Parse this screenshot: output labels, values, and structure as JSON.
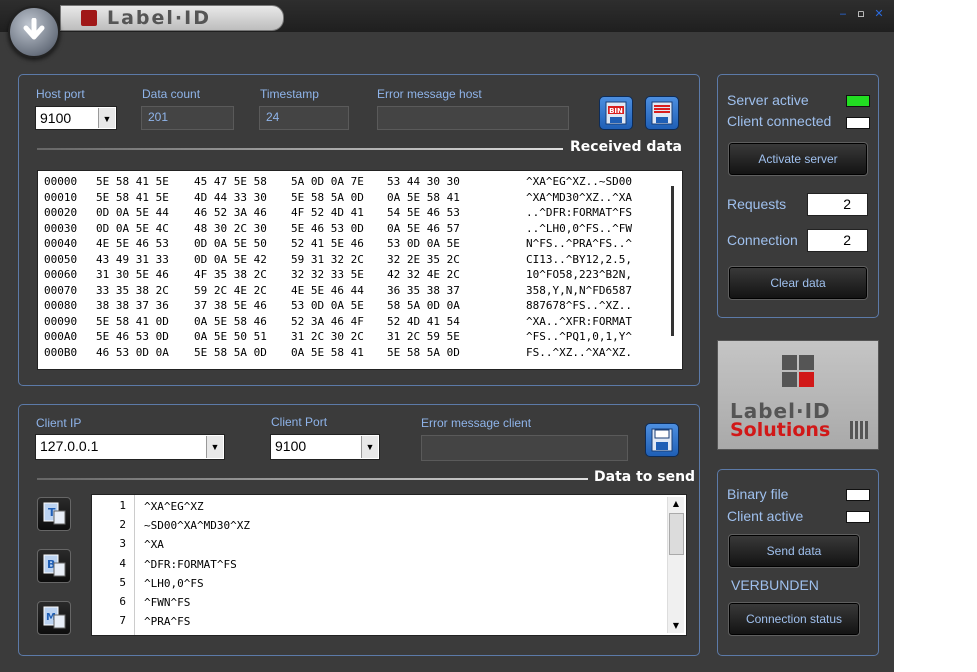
{
  "app": {
    "title": "Label·ID"
  },
  "host": {
    "host_port_label": "Host port",
    "host_port_value": "9100",
    "data_count_label": "Data count",
    "data_count_value": "201",
    "timestamp_label": "Timestamp",
    "timestamp_value": "24",
    "error_label": "Error message host",
    "error_value": "",
    "received_title": "Received data",
    "bin_icon_text": "BIN",
    "hex_rows": [
      {
        "addr": "00000",
        "hex": [
          "5E 58 41 5E",
          "45 47 5E 58",
          "5A 0D 0A 7E",
          "53 44 30 30"
        ],
        "ascii": "^XA^EG^XZ..~SD00"
      },
      {
        "addr": "00010",
        "hex": [
          "5E 58 41 5E",
          "4D 44 33 30",
          "5E 58 5A 0D",
          "0A 5E 58 41"
        ],
        "ascii": "^XA^MD30^XZ..^XA"
      },
      {
        "addr": "00020",
        "hex": [
          "0D 0A 5E 44",
          "46 52 3A 46",
          "4F 52 4D 41",
          "54 5E 46 53"
        ],
        "ascii": "..^DFR:FORMAT^FS"
      },
      {
        "addr": "00030",
        "hex": [
          "0D 0A 5E 4C",
          "48 30 2C 30",
          "5E 46 53 0D",
          "0A 5E 46 57"
        ],
        "ascii": "..^LH0,0^FS..^FW"
      },
      {
        "addr": "00040",
        "hex": [
          "4E 5E 46 53",
          "0D 0A 5E 50",
          "52 41 5E 46",
          "53 0D 0A 5E"
        ],
        "ascii": "N^FS..^PRA^FS..^"
      },
      {
        "addr": "00050",
        "hex": [
          "43 49 31 33",
          "0D 0A 5E 42",
          "59 31 32 2C",
          "32 2E 35 2C"
        ],
        "ascii": "CI13..^BY12,2.5,"
      },
      {
        "addr": "00060",
        "hex": [
          "31 30 5E 46",
          "4F 35 38 2C",
          "32 32 33 5E",
          "42 32 4E 2C"
        ],
        "ascii": "10^FO58,223^B2N,"
      },
      {
        "addr": "00070",
        "hex": [
          "33 35 38 2C",
          "59 2C 4E 2C",
          "4E 5E 46 44",
          "36 35 38 37"
        ],
        "ascii": "358,Y,N,N^FD6587"
      },
      {
        "addr": "00080",
        "hex": [
          "38 38 37 36",
          "37 38 5E 46",
          "53 0D 0A 5E",
          "58 5A 0D 0A"
        ],
        "ascii": "887678^FS..^XZ.."
      },
      {
        "addr": "00090",
        "hex": [
          "5E 58 41 0D",
          "0A 5E 58 46",
          "52 3A 46 4F",
          "52 4D 41 54"
        ],
        "ascii": "^XA..^XFR:FORMAT"
      },
      {
        "addr": "000A0",
        "hex": [
          "5E 46 53 0D",
          "0A 5E 50 51",
          "31 2C 30 2C",
          "31 2C 59 5E"
        ],
        "ascii": "^FS..^PQ1,0,1,Y^"
      },
      {
        "addr": "000B0",
        "hex": [
          "46 53 0D 0A",
          "5E 58 5A 0D",
          "0A 5E 58 41",
          "5E 58 5A 0D"
        ],
        "ascii": "FS..^XZ..^XA^XZ."
      }
    ]
  },
  "client": {
    "client_ip_label": "Client IP",
    "client_ip_value": "127.0.0.1",
    "client_port_label": "Client Port",
    "client_port_value": "9100",
    "error_label": "Error message client",
    "error_value": "",
    "send_title": "Data to send",
    "lines": [
      "^XA^EG^XZ",
      "~SD00^XA^MD30^XZ",
      "^XA",
      "^DFR:FORMAT^FS",
      "^LH0,0^FS",
      "^FWN^FS",
      "^PRA^FS",
      ""
    ]
  },
  "server": {
    "server_active_label": "Server active",
    "client_connected_label": "Client connected",
    "activate_label": "Activate server",
    "requests_label": "Requests",
    "requests_value": "2",
    "connection_label": "Connection",
    "connection_value": "2",
    "clear_label": "Clear data",
    "colors": {
      "server_led": "#22dd22",
      "client_led": "#ffffff"
    }
  },
  "logo": {
    "line1": "Label·ID",
    "line2": "Solutions"
  },
  "status": {
    "binary_label": "Binary file",
    "client_active_label": "Client active",
    "send_label": "Send data",
    "state_text": "VERBUNDEN",
    "conn_status_label": "Connection status"
  }
}
